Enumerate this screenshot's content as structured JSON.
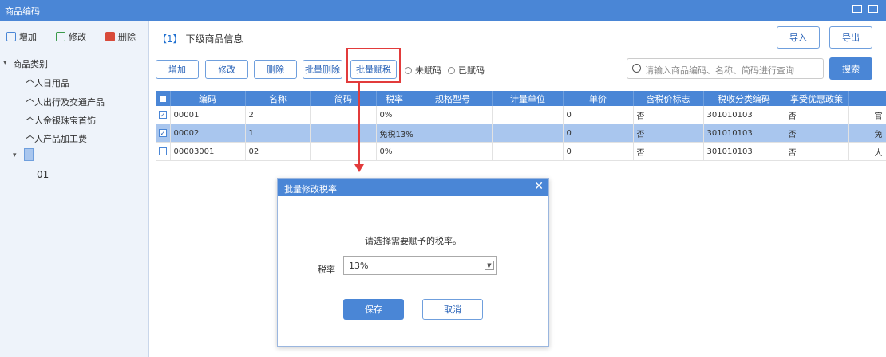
{
  "window": {
    "title": "商品编码",
    "min_icon": "minimize-icon",
    "close_icon": "close-icon"
  },
  "sidebar": {
    "buttons": [
      {
        "label": "增加",
        "icon": "add-icon"
      },
      {
        "label": "修改",
        "icon": "edit-icon"
      },
      {
        "label": "删除",
        "icon": "delete-icon"
      }
    ],
    "tree": {
      "root": "商品类别",
      "items": [
        "个人日用品",
        "个人出行及交通产品",
        "个人金银珠宝首饰",
        "个人产品加工费"
      ],
      "child": "01"
    }
  },
  "main": {
    "header": {
      "bracket": "【1】",
      "title": "下级商品信息"
    },
    "toolbar": {
      "add": "增加",
      "edit": "修改",
      "delete": "删除",
      "batch_delete": "批量删除",
      "batch_tax": "批量赋税",
      "radio_unset": "未赋码",
      "radio_set": "已赋码"
    },
    "search": {
      "placeholder": "请输入商品编码、名称、简码进行查询",
      "button": "搜索"
    },
    "import": "导入",
    "export": "导出",
    "table": {
      "columns": [
        "编码",
        "名称",
        "简码",
        "税率",
        "规格型号",
        "计量单位",
        "单价",
        "含税价标志",
        "税收分类编码",
        "享受优惠政策"
      ],
      "rows": [
        {
          "checked": true,
          "cells": [
            "00001",
            "2",
            "",
            "0%",
            "",
            "",
            "0",
            "否",
            "301010103",
            "否",
            "官"
          ],
          "selected": false
        },
        {
          "checked": true,
          "cells": [
            "00002",
            "1",
            "",
            "免税13%",
            "",
            "",
            "0",
            "否",
            "301010103",
            "否",
            "免"
          ],
          "selected": true
        },
        {
          "checked": false,
          "cells": [
            "00003001",
            "02",
            "",
            "0%",
            "",
            "",
            "0",
            "否",
            "301010103",
            "否",
            "大"
          ],
          "selected": false
        }
      ]
    }
  },
  "dialog": {
    "title": "批量修改税率",
    "close": "✕",
    "message": "请选择需要赋予的税率。",
    "label": "税率",
    "value": "13%",
    "ok": "保存",
    "cancel": "取消"
  }
}
